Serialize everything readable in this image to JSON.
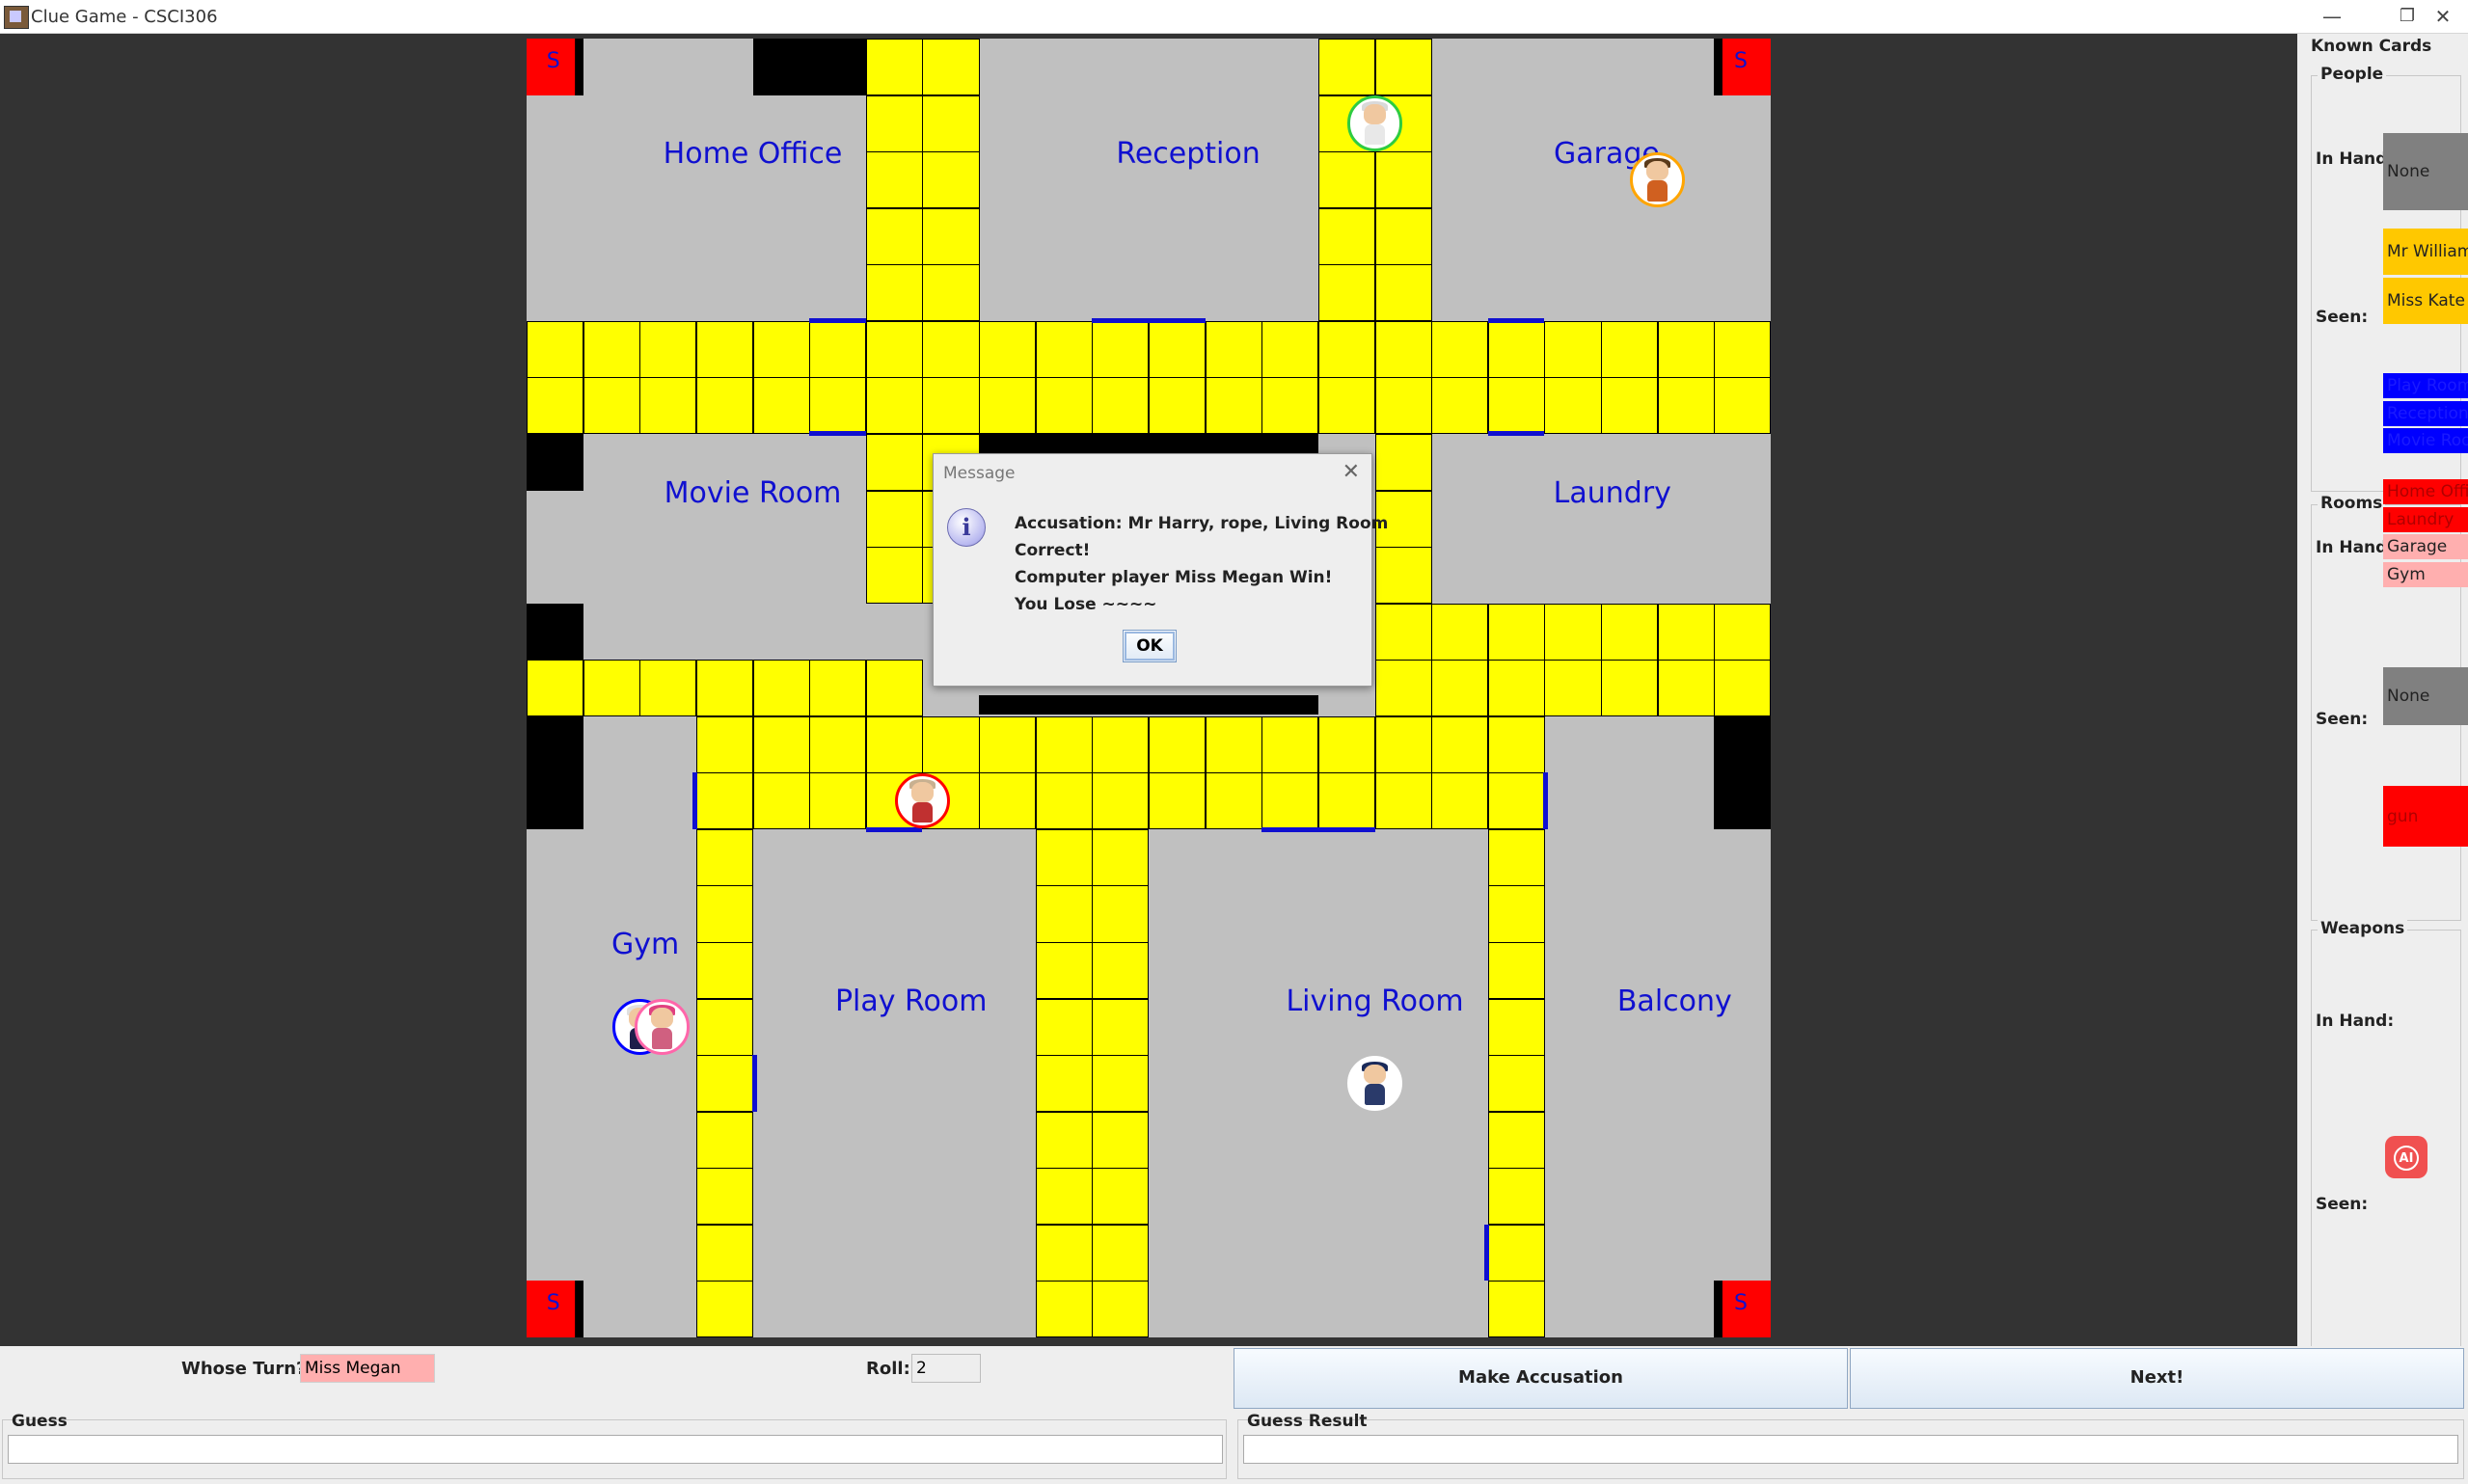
{
  "window": {
    "title": "Clue Game - CSCI306",
    "minimize": "—",
    "restore": "❐",
    "close": "✕"
  },
  "board": {
    "rooms": [
      {
        "name": "Home Office",
        "row": 2,
        "col": 3.5
      },
      {
        "name": "Reception",
        "row": 2,
        "col": 11.2
      },
      {
        "name": "Garage",
        "row": 2,
        "col": 18.6
      },
      {
        "name": "Movie Room",
        "row": 8,
        "col": 3.5
      },
      {
        "name": "Laundry",
        "row": 8,
        "col": 18.7
      },
      {
        "name": "Gym",
        "row": 16,
        "col": 1.6
      },
      {
        "name": "Play Room",
        "row": 17,
        "col": 6.3
      },
      {
        "name": "Living Room",
        "row": 17,
        "col": 14.5
      },
      {
        "name": "Balcony",
        "row": 17,
        "col": 19.8
      }
    ],
    "start_label": "S",
    "colors": {
      "walkway": "#ffff00",
      "room": "#c0c0c0",
      "door": "#1010d0",
      "start": "#ff0000",
      "label": "#1010d0"
    }
  },
  "players": [
    {
      "name": "player-green",
      "ring": "#2ecc40",
      "row": 1.5,
      "col": 14.5,
      "hair": "#d9d9d9",
      "body": "#e8e8e8"
    },
    {
      "name": "player-orange",
      "ring": "#ffa500",
      "row": 2.5,
      "col": 19.5,
      "hair": "#5a3a1a",
      "body": "#d06020"
    },
    {
      "name": "player-red",
      "ring": "#ff0000",
      "row": 13.5,
      "col": 6.5,
      "hair": "#c8b090",
      "body": "#c03030"
    },
    {
      "name": "player-blue",
      "ring": "#0000ff",
      "row": 17.5,
      "col": 1.5,
      "hair": "#e0e0e0",
      "body": "#1e1e4a"
    },
    {
      "name": "player-pink",
      "ring": "#ff66aa",
      "row": 17.5,
      "col": 1.9,
      "hair": "#e04080",
      "body": "#d06080"
    },
    {
      "name": "player-navy",
      "ring": "#ffffff",
      "row": 18.5,
      "col": 14.5,
      "hair": "#1a2a5a",
      "body": "#2a3a6a"
    }
  ],
  "known_cards": {
    "title": "Known Cards",
    "people": {
      "title": "People",
      "in_hand_label": "In Hand:",
      "in_hand": [
        {
          "text": "None",
          "color": "#808080"
        }
      ],
      "seen_label": "Seen:",
      "seen": [
        {
          "text": "Mr William",
          "color": "#ffc800"
        },
        {
          "text": "Miss Kate",
          "color": "#ffc800"
        }
      ]
    },
    "rooms": {
      "title": "Rooms",
      "in_hand_label": "In Hand:",
      "in_hand": [
        {
          "text": "Play Room",
          "color": "#0000ff"
        },
        {
          "text": "Reception",
          "color": "#0000ff"
        },
        {
          "text": "Movie Room",
          "color": "#0000ff"
        }
      ],
      "seen_label": "Seen:",
      "seen": [
        {
          "text": "Home Office",
          "color": "#ff0000"
        },
        {
          "text": "Laundry",
          "color": "#ff0000"
        },
        {
          "text": "Garage",
          "color": "#ffafaf"
        },
        {
          "text": "Gym",
          "color": "#ffafaf"
        }
      ]
    },
    "weapons": {
      "title": "Weapons",
      "in_hand_label": "In Hand:",
      "in_hand": [
        {
          "text": "None",
          "color": "#808080"
        }
      ],
      "seen_label": "Seen:",
      "seen": [
        {
          "text": "gun",
          "color": "#ff0000"
        }
      ]
    }
  },
  "ai_button": "AI",
  "bottom": {
    "turn_label": "Whose Turn?",
    "turn_value": "Miss Megan",
    "turn_color": "#ffafaf",
    "roll_label": "Roll:",
    "roll_value": "2",
    "accuse_label": "Make Accusation",
    "next_label": "Next!",
    "guess_label": "Guess",
    "guess_value": "",
    "guess_result_label": "Guess Result",
    "guess_result_value": ""
  },
  "dialog": {
    "title": "Message",
    "close": "✕",
    "icon": "i",
    "lines": [
      "Accusation: Mr Harry, rope, Living Room",
      "Correct!",
      "Computer player Miss Megan Win!",
      "You Lose ~~~~"
    ],
    "ok": "OK"
  }
}
